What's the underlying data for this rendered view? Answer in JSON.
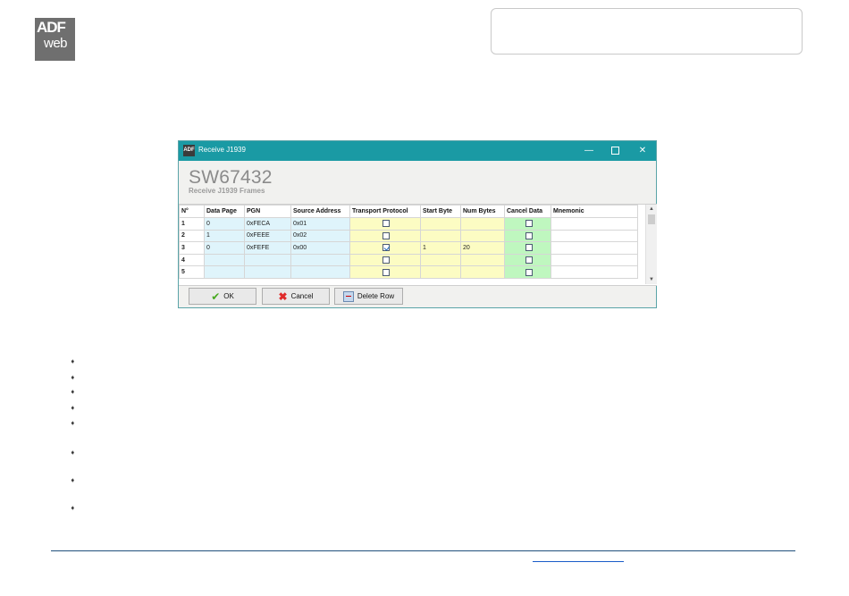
{
  "logo": {
    "line1": "ADF",
    "line2": "web"
  },
  "window": {
    "title": "Receive J1939",
    "app_icon_text": "ADF",
    "minimize_glyph": "—",
    "close_glyph": "✕",
    "app_title": "SW67432",
    "app_subtitle": "Receive J1939 Frames"
  },
  "grid": {
    "columns": [
      "N°",
      "Data Page",
      "PGN",
      "Source Address",
      "Transport Protocol",
      "Start Byte",
      "Num Bytes",
      "Cancel Data",
      "Mnemonic"
    ],
    "rows": [
      {
        "n": "1",
        "data_page": "0",
        "pgn": "0xFECA",
        "source": "0x01",
        "transport": false,
        "start": "",
        "num": "",
        "cancel": false,
        "mnemonic": ""
      },
      {
        "n": "2",
        "data_page": "1",
        "pgn": "0xFEEE",
        "source": "0x02",
        "transport": false,
        "start": "",
        "num": "",
        "cancel": false,
        "mnemonic": ""
      },
      {
        "n": "3",
        "data_page": "0",
        "pgn": "0xFEFE",
        "source": "0x00",
        "transport": true,
        "start": "1",
        "num": "20",
        "cancel": false,
        "mnemonic": ""
      },
      {
        "n": "4",
        "data_page": "",
        "pgn": "",
        "source": "",
        "transport": false,
        "start": "",
        "num": "",
        "cancel": false,
        "mnemonic": ""
      },
      {
        "n": "5",
        "data_page": "",
        "pgn": "",
        "source": "",
        "transport": false,
        "start": "",
        "num": "",
        "cancel": false,
        "mnemonic": ""
      }
    ]
  },
  "buttons": {
    "ok": "OK",
    "cancel": "Cancel",
    "delete_row": "Delete Row"
  },
  "colors": {
    "titlebar": "#1a9aa4",
    "data_cells": "#dff4fb",
    "transport_cells": "#fcfcc3",
    "cancel_cells": "#bff7bf",
    "footer_line": "#1f4f7c"
  },
  "bullet_glyph": "➧",
  "bullet_count": 8
}
